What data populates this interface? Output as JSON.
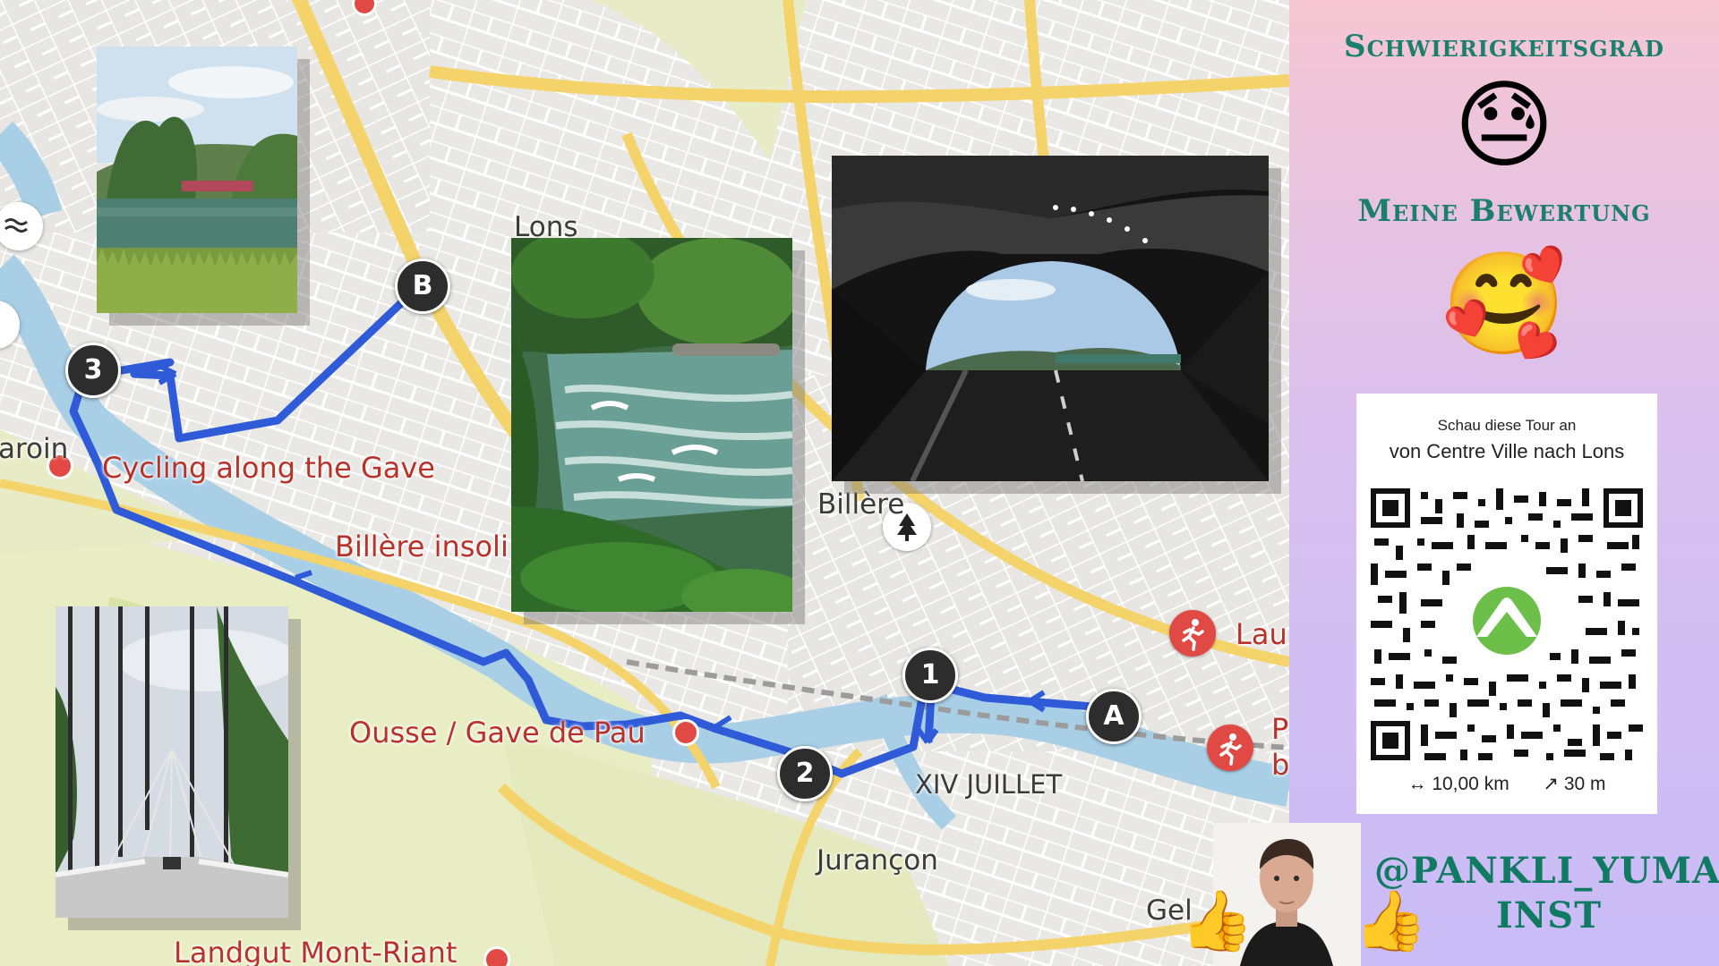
{
  "map": {
    "route_markers": {
      "start": "A",
      "end": "B",
      "wp1": "1",
      "wp2": "2",
      "wp3": "3"
    },
    "poi_labels": {
      "cycling": "Cycling along the Gave",
      "billere_insolite": "Billère insoli",
      "ousse": "Ousse / Gave de Pau",
      "landgut": "Landgut Mont-Riant",
      "lau": "Lau",
      "p": "P",
      "b": "b"
    },
    "place_labels": {
      "lons": "Lons",
      "billere": "Billère",
      "xiv_juillet": "XIV JUILLET",
      "jurancon": "Jurançon",
      "gel": "Gel",
      "laroin": "aroin"
    },
    "icons": [
      "river-icon",
      "tree-icon",
      "runner-icon",
      "poi-pin-icon"
    ],
    "colors": {
      "route": "#2f5bd8",
      "poi": "#e14a44",
      "marker": "#2d2d2d",
      "road_yellow": "#f5d36b",
      "river": "#a8cfe6"
    }
  },
  "photos": [
    "lake-photo",
    "river-rapids-photo",
    "tunnel-photo",
    "suspension-bridge-photo"
  ],
  "sidebar": {
    "difficulty_heading": "Schwierigkeitsgrad",
    "difficulty_emoji": "😓",
    "rating_heading": "Meine Bewertung",
    "rating_emoji": "🥰",
    "qr_card": {
      "intro": "Schau diese Tour an",
      "title": "von Centre Ville nach Lons",
      "distance_icon": "↔",
      "distance": "10,00 km",
      "elevation_icon": "↗",
      "elevation": "30 m"
    },
    "handle_line1": "@PANKLI_YUMAN",
    "handle_line2": "INST",
    "thumbs_emoji": "👍",
    "colors": {
      "heading": "#1a7f6c",
      "komoot_green": "#6cc04a"
    }
  }
}
